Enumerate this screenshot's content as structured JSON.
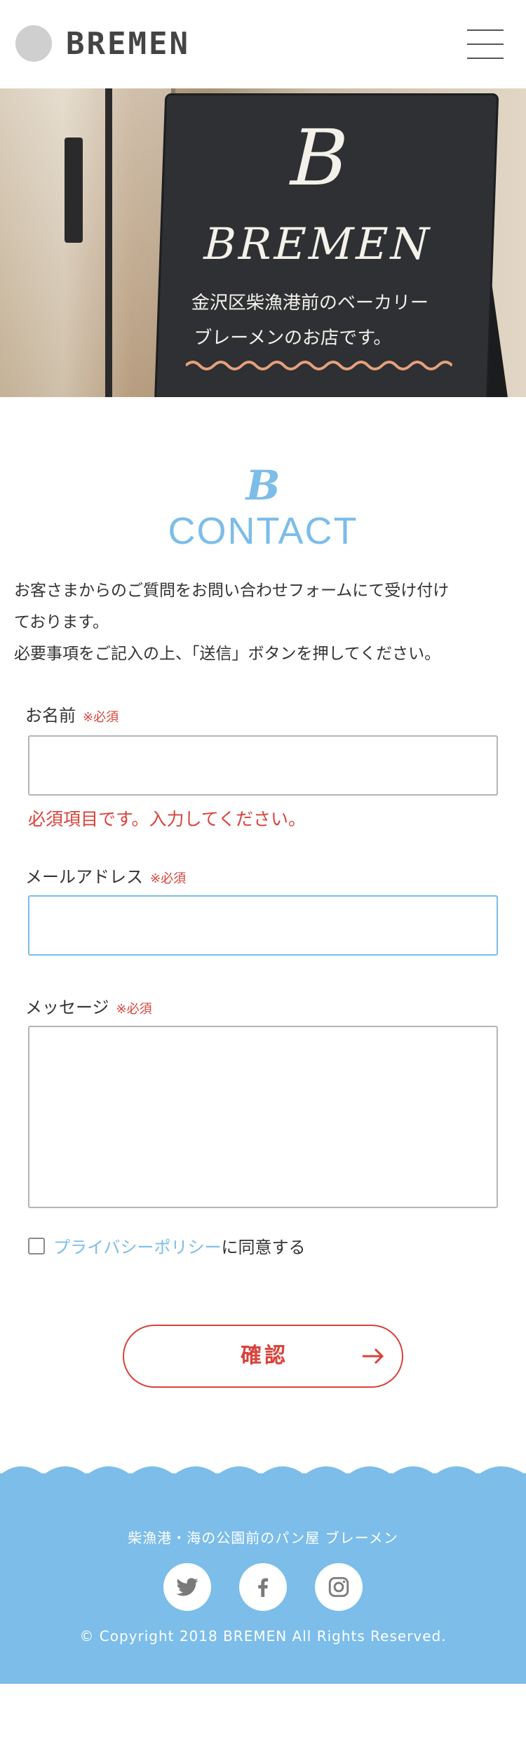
{
  "header": {
    "brand": "BREMEN",
    "menu_icon": "hamburger-menu-icon"
  },
  "hero": {
    "sign_logo": "B",
    "sign_name": "BREMEN",
    "sign_line1": "金沢区柴漁港前のベーカリー",
    "sign_line2": "ブレーメンのお店です。"
  },
  "contact": {
    "logo_mark": "B",
    "title": "CONTACT",
    "intro_lines": [
      "お客さまからのご質問をお問い合わせフォームにて受け付け",
      "ております。",
      "必要事項をご記入の上、「送信」ボタンを押してください。"
    ]
  },
  "form": {
    "required_mark": "※必須",
    "name_label": "お名前",
    "name_value": "",
    "name_error": "必須項目です。入力してください。",
    "email_label": "メールアドレス",
    "email_value": "",
    "message_label": "メッセージ",
    "message_value": "",
    "agree_checked": false,
    "agree_link": "プライバシーポリシー",
    "agree_suffix": "に同意する",
    "confirm_label": "確認"
  },
  "footer": {
    "shop_name": "柴漁港・海の公園前のパン屋 ブレーメン",
    "social_icons": [
      "twitter-icon",
      "facebook-icon",
      "instagram-icon"
    ],
    "copyright": "© Copyright 2018 BREMEN All Rights Reserved."
  },
  "colors": {
    "accent_blue": "#7cbde9",
    "accent_red": "#d9423a",
    "text": "#333333"
  }
}
